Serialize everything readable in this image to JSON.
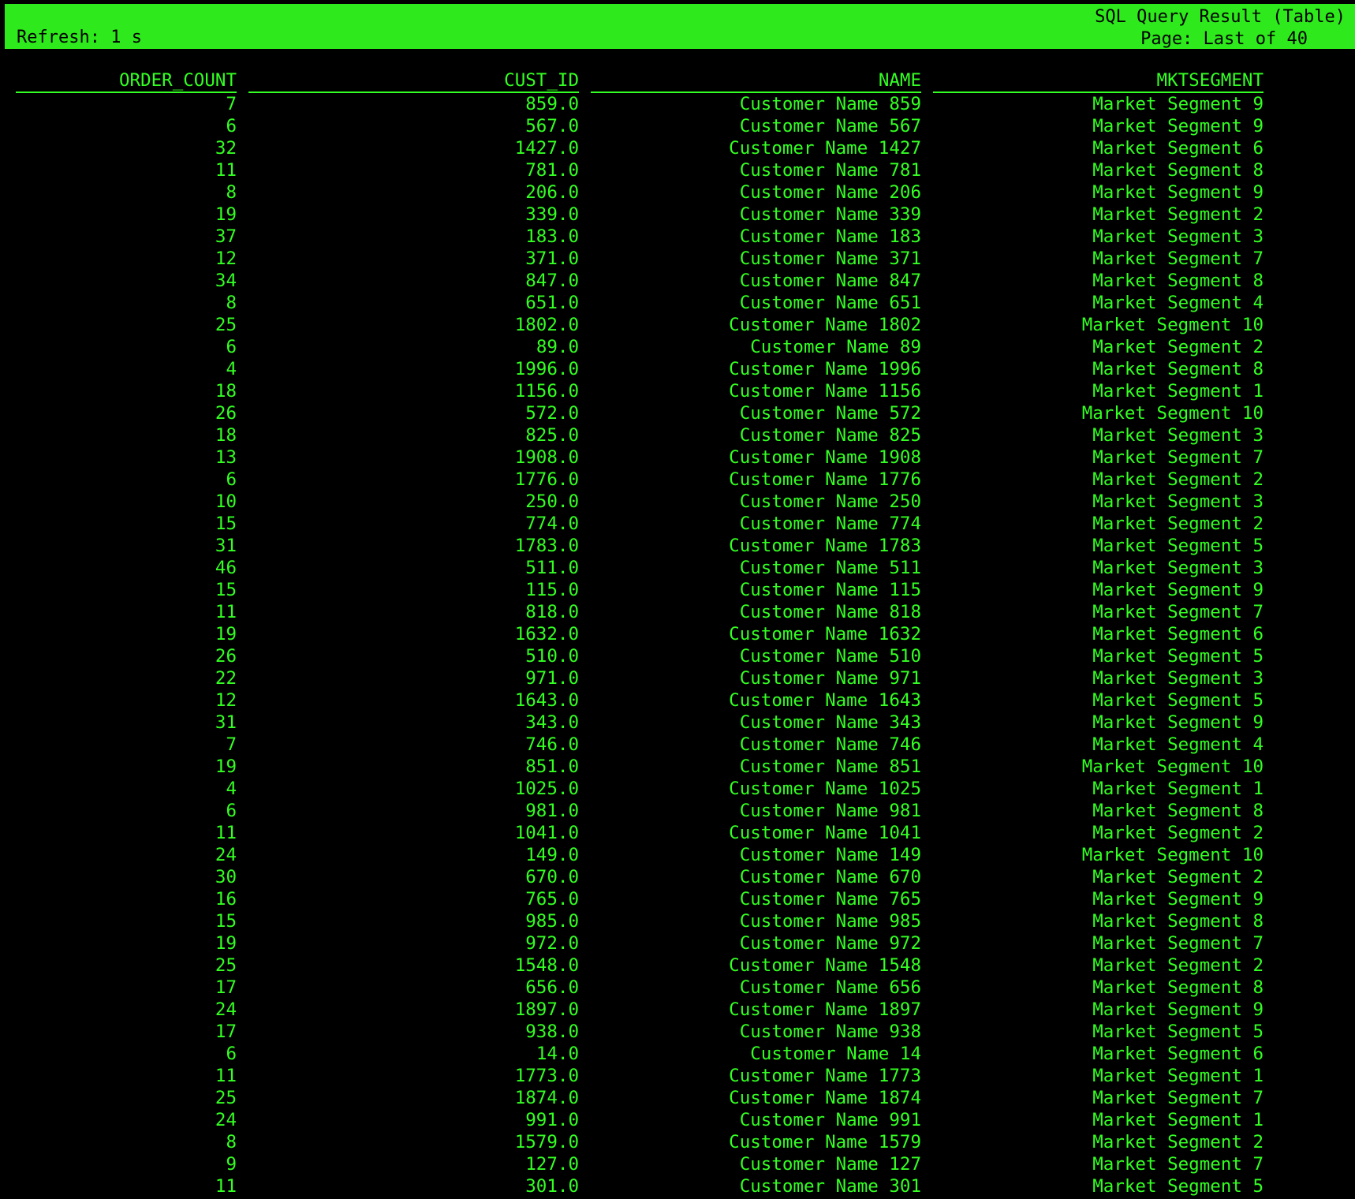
{
  "header": {
    "refresh": "Refresh: 1 s",
    "title": "SQL Query Result (Table)",
    "page": "Page: Last of 40"
  },
  "colors": {
    "header_bg": "#2eea1c",
    "text": "#33ff22",
    "background": "#000000"
  },
  "table": {
    "columns": [
      "ORDER_COUNT",
      "CUST_ID",
      "NAME",
      "MKTSEGMENT"
    ],
    "rows": [
      [
        "7",
        "859.0",
        "Customer Name 859",
        "Market Segment 9"
      ],
      [
        "6",
        "567.0",
        "Customer Name 567",
        "Market Segment 9"
      ],
      [
        "32",
        "1427.0",
        "Customer Name 1427",
        "Market Segment 6"
      ],
      [
        "11",
        "781.0",
        "Customer Name 781",
        "Market Segment 8"
      ],
      [
        "8",
        "206.0",
        "Customer Name 206",
        "Market Segment 9"
      ],
      [
        "19",
        "339.0",
        "Customer Name 339",
        "Market Segment 2"
      ],
      [
        "37",
        "183.0",
        "Customer Name 183",
        "Market Segment 3"
      ],
      [
        "12",
        "371.0",
        "Customer Name 371",
        "Market Segment 7"
      ],
      [
        "34",
        "847.0",
        "Customer Name 847",
        "Market Segment 8"
      ],
      [
        "8",
        "651.0",
        "Customer Name 651",
        "Market Segment 4"
      ],
      [
        "25",
        "1802.0",
        "Customer Name 1802",
        "Market Segment 10"
      ],
      [
        "6",
        "89.0",
        "Customer Name 89",
        "Market Segment 2"
      ],
      [
        "4",
        "1996.0",
        "Customer Name 1996",
        "Market Segment 8"
      ],
      [
        "18",
        "1156.0",
        "Customer Name 1156",
        "Market Segment 1"
      ],
      [
        "26",
        "572.0",
        "Customer Name 572",
        "Market Segment 10"
      ],
      [
        "18",
        "825.0",
        "Customer Name 825",
        "Market Segment 3"
      ],
      [
        "13",
        "1908.0",
        "Customer Name 1908",
        "Market Segment 7"
      ],
      [
        "6",
        "1776.0",
        "Customer Name 1776",
        "Market Segment 2"
      ],
      [
        "10",
        "250.0",
        "Customer Name 250",
        "Market Segment 3"
      ],
      [
        "15",
        "774.0",
        "Customer Name 774",
        "Market Segment 2"
      ],
      [
        "31",
        "1783.0",
        "Customer Name 1783",
        "Market Segment 5"
      ],
      [
        "46",
        "511.0",
        "Customer Name 511",
        "Market Segment 3"
      ],
      [
        "15",
        "115.0",
        "Customer Name 115",
        "Market Segment 9"
      ],
      [
        "11",
        "818.0",
        "Customer Name 818",
        "Market Segment 7"
      ],
      [
        "19",
        "1632.0",
        "Customer Name 1632",
        "Market Segment 6"
      ],
      [
        "26",
        "510.0",
        "Customer Name 510",
        "Market Segment 5"
      ],
      [
        "22",
        "971.0",
        "Customer Name 971",
        "Market Segment 3"
      ],
      [
        "12",
        "1643.0",
        "Customer Name 1643",
        "Market Segment 5"
      ],
      [
        "31",
        "343.0",
        "Customer Name 343",
        "Market Segment 9"
      ],
      [
        "7",
        "746.0",
        "Customer Name 746",
        "Market Segment 4"
      ],
      [
        "19",
        "851.0",
        "Customer Name 851",
        "Market Segment 10"
      ],
      [
        "4",
        "1025.0",
        "Customer Name 1025",
        "Market Segment 1"
      ],
      [
        "6",
        "981.0",
        "Customer Name 981",
        "Market Segment 8"
      ],
      [
        "11",
        "1041.0",
        "Customer Name 1041",
        "Market Segment 2"
      ],
      [
        "24",
        "149.0",
        "Customer Name 149",
        "Market Segment 10"
      ],
      [
        "30",
        "670.0",
        "Customer Name 670",
        "Market Segment 2"
      ],
      [
        "16",
        "765.0",
        "Customer Name 765",
        "Market Segment 9"
      ],
      [
        "15",
        "985.0",
        "Customer Name 985",
        "Market Segment 8"
      ],
      [
        "19",
        "972.0",
        "Customer Name 972",
        "Market Segment 7"
      ],
      [
        "25",
        "1548.0",
        "Customer Name 1548",
        "Market Segment 2"
      ],
      [
        "17",
        "656.0",
        "Customer Name 656",
        "Market Segment 8"
      ],
      [
        "24",
        "1897.0",
        "Customer Name 1897",
        "Market Segment 9"
      ],
      [
        "17",
        "938.0",
        "Customer Name 938",
        "Market Segment 5"
      ],
      [
        "6",
        "14.0",
        "Customer Name 14",
        "Market Segment 6"
      ],
      [
        "11",
        "1773.0",
        "Customer Name 1773",
        "Market Segment 1"
      ],
      [
        "25",
        "1874.0",
        "Customer Name 1874",
        "Market Segment 7"
      ],
      [
        "24",
        "991.0",
        "Customer Name 991",
        "Market Segment 1"
      ],
      [
        "8",
        "1579.0",
        "Customer Name 1579",
        "Market Segment 2"
      ],
      [
        "9",
        "127.0",
        "Customer Name 127",
        "Market Segment 7"
      ],
      [
        "11",
        "301.0",
        "Customer Name 301",
        "Market Segment 5"
      ]
    ]
  }
}
